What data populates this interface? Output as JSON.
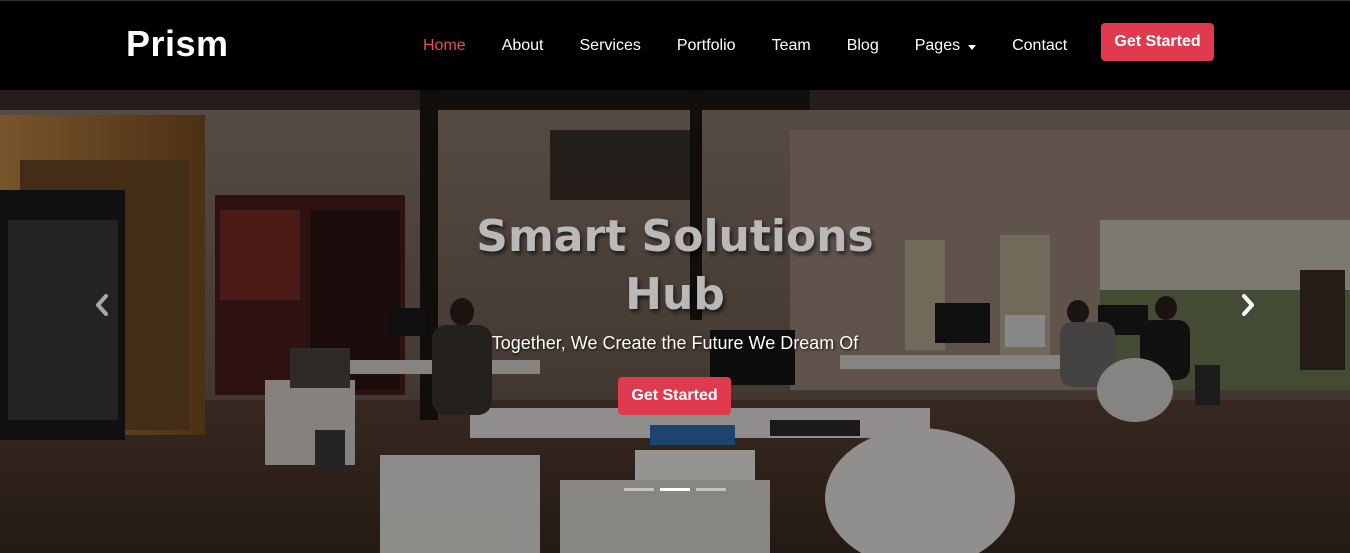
{
  "brand": {
    "name": "Prism"
  },
  "nav": {
    "items": [
      {
        "label": "Home"
      },
      {
        "label": "About"
      },
      {
        "label": "Services"
      },
      {
        "label": "Portfolio"
      },
      {
        "label": "Team"
      },
      {
        "label": "Blog"
      },
      {
        "label": "Pages"
      },
      {
        "label": "Contact"
      }
    ],
    "cta_label": "Get Started",
    "active_color": "#e84a5f"
  },
  "hero": {
    "title": "Smart Solutions Hub",
    "subtitle": "Together, We Create the Future We Dream Of",
    "button_label": "Get Started",
    "prev_icon": "chevron-left-icon",
    "next_icon": "chevron-right-icon",
    "slide_count": 3,
    "active_slide": 2
  },
  "colors": {
    "accent": "#e03a4e",
    "header_bg": "#000000"
  }
}
